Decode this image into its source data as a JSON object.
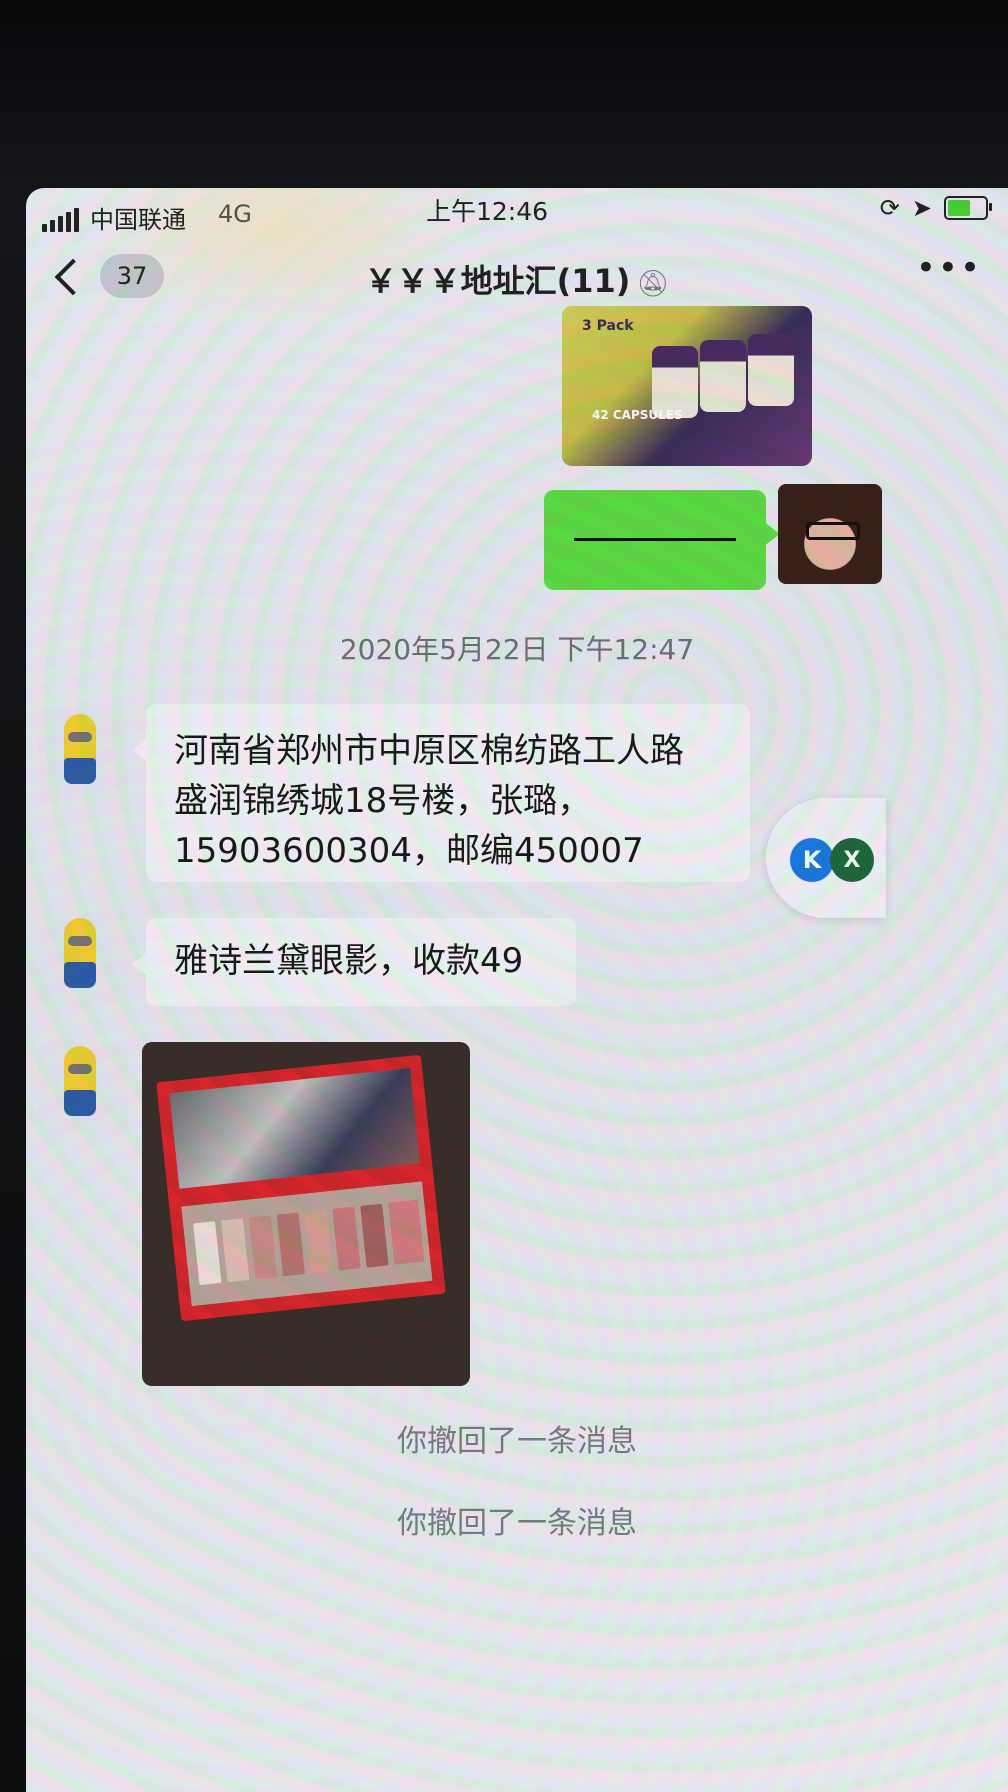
{
  "status_bar": {
    "carrier": "中国联通",
    "network": "4G",
    "time": "上午12:46",
    "battery_level": 0.6
  },
  "nav": {
    "unread_count": "37",
    "title": "￥￥￥地址汇(11)",
    "icons": {
      "back": "chevron-left-icon",
      "mute": "bell-off-icon",
      "more": "more-dots-icon"
    }
  },
  "messages": {
    "image_1": {
      "pack_text": "3 Pack",
      "capsules_text": "42 CAPSULES"
    },
    "timestamp": "2020年5月22日 下午12:47",
    "address_lines": [
      "河南省郑州市中原区棉纺路工人路",
      "盛润锦绣城18号楼，张璐，",
      "15903600304，邮编450007"
    ],
    "order_text": "雅诗兰黛眼影，收款49",
    "recalled_1": "你撤回了一条消息",
    "recalled_2": "你撤回了一条消息"
  },
  "widget": {
    "k_label": "K",
    "x_label": "X"
  },
  "colors": {
    "my_bubble": "#5fde45",
    "other_bubble": "#f5f6f8",
    "battery_fill": "#4cd137"
  }
}
